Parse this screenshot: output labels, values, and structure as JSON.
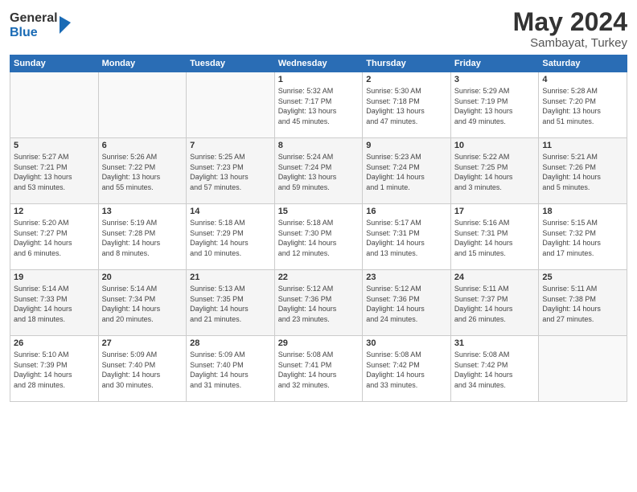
{
  "header": {
    "logo_general": "General",
    "logo_blue": "Blue",
    "month_year": "May 2024",
    "location": "Sambayat, Turkey"
  },
  "days_of_week": [
    "Sunday",
    "Monday",
    "Tuesday",
    "Wednesday",
    "Thursday",
    "Friday",
    "Saturday"
  ],
  "weeks": [
    [
      {
        "day": "",
        "info": ""
      },
      {
        "day": "",
        "info": ""
      },
      {
        "day": "",
        "info": ""
      },
      {
        "day": "1",
        "info": "Sunrise: 5:32 AM\nSunset: 7:17 PM\nDaylight: 13 hours\nand 45 minutes."
      },
      {
        "day": "2",
        "info": "Sunrise: 5:30 AM\nSunset: 7:18 PM\nDaylight: 13 hours\nand 47 minutes."
      },
      {
        "day": "3",
        "info": "Sunrise: 5:29 AM\nSunset: 7:19 PM\nDaylight: 13 hours\nand 49 minutes."
      },
      {
        "day": "4",
        "info": "Sunrise: 5:28 AM\nSunset: 7:20 PM\nDaylight: 13 hours\nand 51 minutes."
      }
    ],
    [
      {
        "day": "5",
        "info": "Sunrise: 5:27 AM\nSunset: 7:21 PM\nDaylight: 13 hours\nand 53 minutes."
      },
      {
        "day": "6",
        "info": "Sunrise: 5:26 AM\nSunset: 7:22 PM\nDaylight: 13 hours\nand 55 minutes."
      },
      {
        "day": "7",
        "info": "Sunrise: 5:25 AM\nSunset: 7:23 PM\nDaylight: 13 hours\nand 57 minutes."
      },
      {
        "day": "8",
        "info": "Sunrise: 5:24 AM\nSunset: 7:24 PM\nDaylight: 13 hours\nand 59 minutes."
      },
      {
        "day": "9",
        "info": "Sunrise: 5:23 AM\nSunset: 7:24 PM\nDaylight: 14 hours\nand 1 minute."
      },
      {
        "day": "10",
        "info": "Sunrise: 5:22 AM\nSunset: 7:25 PM\nDaylight: 14 hours\nand 3 minutes."
      },
      {
        "day": "11",
        "info": "Sunrise: 5:21 AM\nSunset: 7:26 PM\nDaylight: 14 hours\nand 5 minutes."
      }
    ],
    [
      {
        "day": "12",
        "info": "Sunrise: 5:20 AM\nSunset: 7:27 PM\nDaylight: 14 hours\nand 6 minutes."
      },
      {
        "day": "13",
        "info": "Sunrise: 5:19 AM\nSunset: 7:28 PM\nDaylight: 14 hours\nand 8 minutes."
      },
      {
        "day": "14",
        "info": "Sunrise: 5:18 AM\nSunset: 7:29 PM\nDaylight: 14 hours\nand 10 minutes."
      },
      {
        "day": "15",
        "info": "Sunrise: 5:18 AM\nSunset: 7:30 PM\nDaylight: 14 hours\nand 12 minutes."
      },
      {
        "day": "16",
        "info": "Sunrise: 5:17 AM\nSunset: 7:31 PM\nDaylight: 14 hours\nand 13 minutes."
      },
      {
        "day": "17",
        "info": "Sunrise: 5:16 AM\nSunset: 7:31 PM\nDaylight: 14 hours\nand 15 minutes."
      },
      {
        "day": "18",
        "info": "Sunrise: 5:15 AM\nSunset: 7:32 PM\nDaylight: 14 hours\nand 17 minutes."
      }
    ],
    [
      {
        "day": "19",
        "info": "Sunrise: 5:14 AM\nSunset: 7:33 PM\nDaylight: 14 hours\nand 18 minutes."
      },
      {
        "day": "20",
        "info": "Sunrise: 5:14 AM\nSunset: 7:34 PM\nDaylight: 14 hours\nand 20 minutes."
      },
      {
        "day": "21",
        "info": "Sunrise: 5:13 AM\nSunset: 7:35 PM\nDaylight: 14 hours\nand 21 minutes."
      },
      {
        "day": "22",
        "info": "Sunrise: 5:12 AM\nSunset: 7:36 PM\nDaylight: 14 hours\nand 23 minutes."
      },
      {
        "day": "23",
        "info": "Sunrise: 5:12 AM\nSunset: 7:36 PM\nDaylight: 14 hours\nand 24 minutes."
      },
      {
        "day": "24",
        "info": "Sunrise: 5:11 AM\nSunset: 7:37 PM\nDaylight: 14 hours\nand 26 minutes."
      },
      {
        "day": "25",
        "info": "Sunrise: 5:11 AM\nSunset: 7:38 PM\nDaylight: 14 hours\nand 27 minutes."
      }
    ],
    [
      {
        "day": "26",
        "info": "Sunrise: 5:10 AM\nSunset: 7:39 PM\nDaylight: 14 hours\nand 28 minutes."
      },
      {
        "day": "27",
        "info": "Sunrise: 5:09 AM\nSunset: 7:40 PM\nDaylight: 14 hours\nand 30 minutes."
      },
      {
        "day": "28",
        "info": "Sunrise: 5:09 AM\nSunset: 7:40 PM\nDaylight: 14 hours\nand 31 minutes."
      },
      {
        "day": "29",
        "info": "Sunrise: 5:08 AM\nSunset: 7:41 PM\nDaylight: 14 hours\nand 32 minutes."
      },
      {
        "day": "30",
        "info": "Sunrise: 5:08 AM\nSunset: 7:42 PM\nDaylight: 14 hours\nand 33 minutes."
      },
      {
        "day": "31",
        "info": "Sunrise: 5:08 AM\nSunset: 7:42 PM\nDaylight: 14 hours\nand 34 minutes."
      },
      {
        "day": "",
        "info": ""
      }
    ]
  ]
}
